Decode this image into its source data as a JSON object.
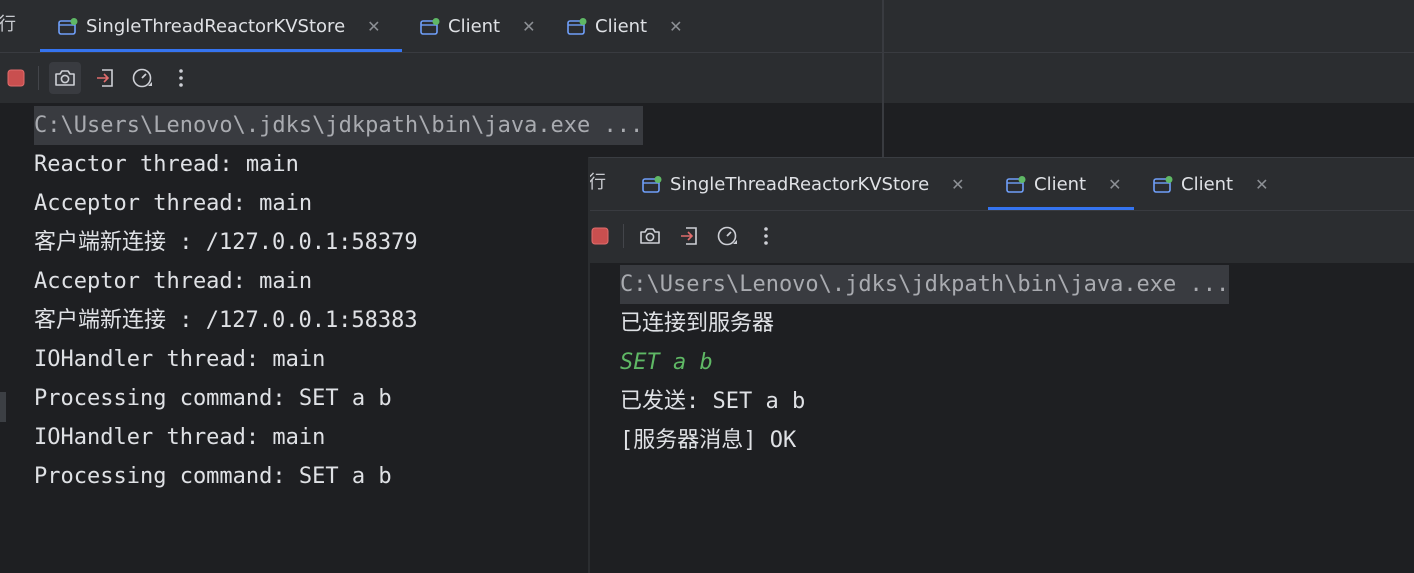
{
  "colors": {
    "background": "#1e1f22",
    "tabbar": "#2b2d30",
    "accent": "#3574f0",
    "text": "#dfe1e5",
    "user_input": "#5fb865",
    "stop_button": "#c94f4f",
    "run_status_dot": "#5fb865"
  },
  "back_window": {
    "edge_glyph": "行",
    "tabs": [
      {
        "label": "SingleThreadReactorKVStore",
        "active": true,
        "icon": "run-config-icon"
      },
      {
        "label": "Client",
        "active": false,
        "icon": "run-config-icon"
      },
      {
        "label": "Client",
        "active": false,
        "icon": "run-config-icon"
      }
    ],
    "toolbar": {
      "items": [
        "stop-icon",
        "camera-icon",
        "exit-login-icon",
        "profiler-gauge-icon",
        "more-vertical-icon"
      ]
    },
    "console_lines": [
      "C:\\Users\\Lenovo\\.jdks\\jdkpath\\bin\\java.exe ...",
      "Reactor thread: main",
      "Acceptor thread: main",
      "客户端新连接 : /127.0.0.1:58379",
      "Acceptor thread: main",
      "客户端新连接 : /127.0.0.1:58383",
      "IOHandler thread: main",
      "Processing command: SET a b",
      "IOHandler thread: main",
      "Processing command: SET a b"
    ]
  },
  "front_window": {
    "edge_glyph": "行",
    "tabs": [
      {
        "label": "SingleThreadReactorKVStore",
        "active": false,
        "icon": "run-config-icon"
      },
      {
        "label": "Client",
        "active": true,
        "icon": "run-config-icon"
      },
      {
        "label": "Client",
        "active": false,
        "icon": "run-config-icon"
      }
    ],
    "toolbar": {
      "items": [
        "stop-icon",
        "camera-icon",
        "exit-login-icon",
        "profiler-gauge-icon",
        "more-vertical-icon"
      ]
    },
    "console_lines": [
      "C:\\Users\\Lenovo\\.jdks\\jdkpath\\bin\\java.exe ...",
      "已连接到服务器",
      "SET a b",
      "已发送: SET a b",
      "[服务器消息] OK"
    ]
  }
}
